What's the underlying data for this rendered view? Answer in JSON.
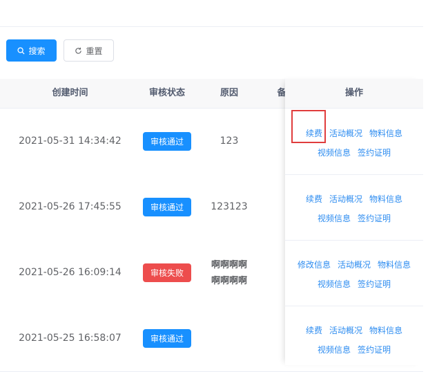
{
  "toolbar": {
    "search_label": "搜索",
    "reset_label": "重置"
  },
  "table": {
    "headers": {
      "created_time": "创建时间",
      "status": "审核状态",
      "reason": "原因",
      "remark": "备",
      "actions": "操作"
    },
    "rows": [
      {
        "time": "2021-05-31 14:34:42",
        "status": "审核通过",
        "status_type": "pass",
        "reason_lines": [
          "123"
        ],
        "actions_line1": [
          "续费",
          "活动概况",
          "物料信息"
        ],
        "actions_line2": [
          "视频信息",
          "签约证明"
        ]
      },
      {
        "time": "2021-05-26 17:45:55",
        "status": "审核通过",
        "status_type": "pass",
        "reason_lines": [
          "123123"
        ],
        "actions_line1": [
          "续费",
          "活动概况",
          "物料信息"
        ],
        "actions_line2": [
          "视频信息",
          "签约证明"
        ]
      },
      {
        "time": "2021-05-26 16:09:14",
        "status": "审核失败",
        "status_type": "fail",
        "reason_lines": [
          "啊啊啊啊",
          "啊啊啊啊"
        ],
        "actions_line1": [
          "修改信息",
          "活动概况",
          "物料信息"
        ],
        "actions_line2": [
          "视频信息",
          "签约证明"
        ]
      },
      {
        "time": "2021-05-25 16:58:07",
        "status": "审核通过",
        "status_type": "pass",
        "reason_lines": [
          ""
        ],
        "actions_line1": [
          "续费",
          "活动概况",
          "物料信息"
        ],
        "actions_line2": [
          "视频信息",
          "签约证明"
        ]
      }
    ]
  },
  "colors": {
    "primary": "#1890ff",
    "danger": "#ed4d4d",
    "link": "#2d8cf0",
    "highlight": "#e03c3c"
  }
}
